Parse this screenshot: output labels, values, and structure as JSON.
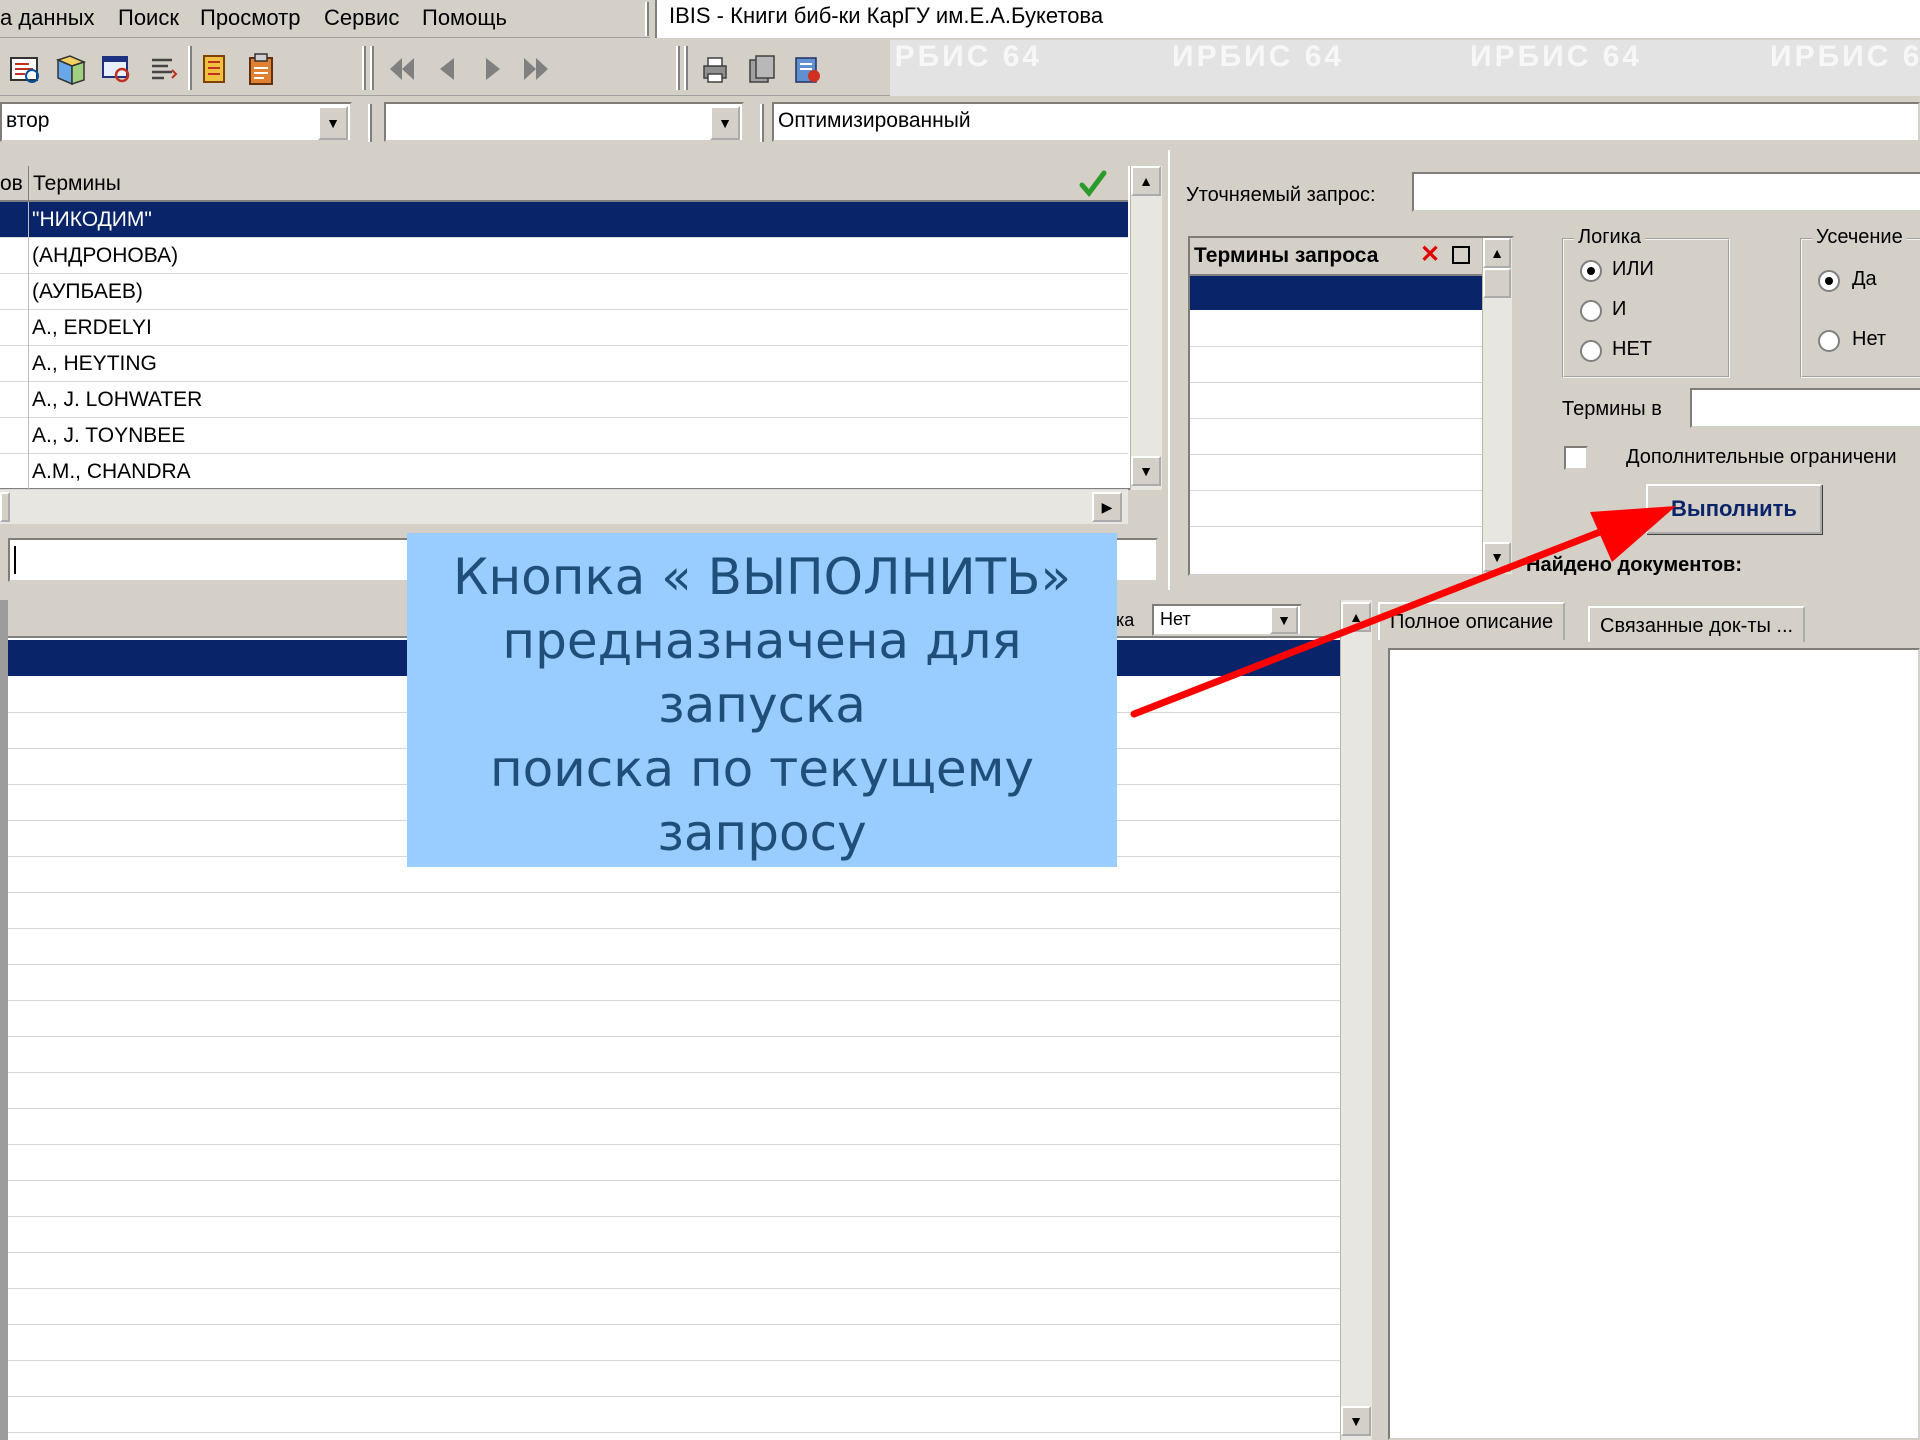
{
  "menu": [
    "а данных",
    "Поиск",
    "Просмотр",
    "Сервис",
    "Помощь"
  ],
  "window_title": "IBIS - Книги биб-ки КарГУ им.Е.А.Букетова",
  "banner_text": "ИРБИС 64",
  "combos": {
    "field": "втор",
    "second": "",
    "mode": "Оптимизированный"
  },
  "terms_grid": {
    "col_left": "ов",
    "col_terms": "Термины",
    "rows": [
      "\"НИКОДИМ\"",
      "(АНДРОНОВА)",
      "(АУПБАЕВ)",
      "А., ERDELYI",
      "А., HEYTING",
      "А., J. LOHWATER",
      "А., J. TOYNBEE",
      "А.М., CHANDRA"
    ]
  },
  "right_panel": {
    "refine_label": "Уточняемый запрос:",
    "query_terms_header": "Термины запроса",
    "logic_title": "Логика",
    "logic_options": [
      "ИЛИ",
      "И",
      "НЕТ"
    ],
    "logic_selected": "ИЛИ",
    "trunc_title": "Усечение",
    "trunc_options": [
      "Да",
      "Нет"
    ],
    "trunc_selected": "Да",
    "terms_in_label": "Термины в",
    "extra_label": "Дополнительные ограничени",
    "execute_button": "Выполнить",
    "found_label": "Найдено документов:"
  },
  "lower": {
    "sort_label_fragment": "ка",
    "sort_value": "Нет",
    "tabs": [
      "Полное описание",
      "Связанные док-ты ..."
    ]
  },
  "callout": {
    "lines": [
      "Кнопка « ВЫПОЛНИТЬ»",
      "предназначена для",
      "запуска",
      "поиска по текущему",
      "запросу"
    ]
  },
  "colors": {
    "selection": "#0a246a",
    "callout_bg": "#99ccff",
    "callout_text": "#1f4e79",
    "arrow": "#ff0000"
  }
}
